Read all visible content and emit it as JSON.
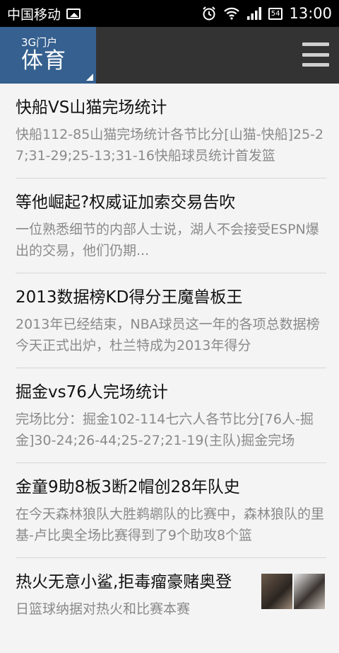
{
  "status_bar": {
    "carrier": "中国移动",
    "battery": "54",
    "time": "13:00"
  },
  "header": {
    "logo_sub": "3G门户",
    "logo_main": "体育"
  },
  "news": [
    {
      "title": "快船VS山猫完场统计",
      "summary": "快船112-85山猫完场统计各节比分[山猫-快船]25-27;31-29;25-13;31-16快船球员统计首发篮"
    },
    {
      "title": "等他崛起?权威证加索交易告吹",
      "summary": "一位熟悉细节的内部人士说，湖人不会接受ESPN爆出的交易，他们仍期..."
    },
    {
      "title": "2013数据榜KD得分王魔兽板王",
      "summary": "2013年已经结束，NBA球员这一年的各项总数据榜今天正式出炉，杜兰特成为2013年得分"
    },
    {
      "title": "掘金vs76人完场统计",
      "summary": "完场比分：掘金102-114七六人各节比分[76人-掘金]30-24;26-44;25-27;21-19(主队)掘金完场"
    },
    {
      "title": "金童9助8板3断2帽创28年队史",
      "summary": "在今天森林狼队大胜鹈鹕队的比赛中，森林狼队的里基-卢比奥全场比赛得到了9个助攻8个篮"
    },
    {
      "title": "热火无意小鲨,拒毒瘤豪赌奥登",
      "summary": "日篮球纳据对热火和比赛本赛"
    }
  ]
}
